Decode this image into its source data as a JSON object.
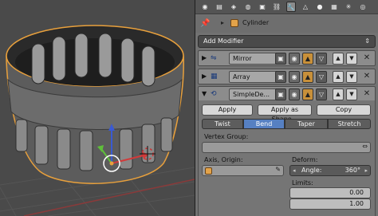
{
  "object": {
    "name": "Cylinder"
  },
  "toolbar": {
    "tabs": [
      {
        "icon": "render-icon",
        "glyph": "◉"
      },
      {
        "icon": "layers-icon",
        "glyph": "▤"
      },
      {
        "icon": "scene-icon",
        "glyph": "◈"
      },
      {
        "icon": "world-icon",
        "glyph": "◍"
      },
      {
        "icon": "object-icon",
        "glyph": "▣"
      },
      {
        "icon": "constraints-icon",
        "glyph": "⛓"
      },
      {
        "icon": "modifiers-icon",
        "glyph": "🔧"
      },
      {
        "icon": "data-icon",
        "glyph": "△"
      },
      {
        "icon": "material-icon",
        "glyph": "●"
      },
      {
        "icon": "texture-icon",
        "glyph": "▦"
      },
      {
        "icon": "particles-icon",
        "glyph": "✳"
      },
      {
        "icon": "physics-icon",
        "glyph": "◎"
      }
    ],
    "active_tab": "modifiers-icon"
  },
  "add_modifier": {
    "label": "Add Modifier"
  },
  "modifiers": [
    {
      "name": "Mirror",
      "expanded": false,
      "icon": "mirror-icon"
    },
    {
      "name": "Array",
      "expanded": false,
      "icon": "array-icon"
    },
    {
      "name": "SimpleDe...",
      "expanded": true,
      "icon": "simpledeform-icon"
    }
  ],
  "simple_deform": {
    "apply_label": "Apply",
    "apply_shape_label": "Apply as Shape...",
    "copy_label": "Copy",
    "modes": [
      "Twist",
      "Bend",
      "Taper",
      "Stretch"
    ],
    "active_mode": "Bend",
    "vertex_group_label": "Vertex Group:",
    "vertex_group_value": "",
    "axis_origin_label": "Axis, Origin:",
    "axis_origin_value": "",
    "deform_label": "Deform:",
    "angle_label": "Angle:",
    "angle_value": "360°",
    "limits_label": "Limits:",
    "limit_min": "0.00",
    "limit_max": "1.00"
  },
  "colors": {
    "selected_mode": "#5680c2",
    "selection_outline": "#e8a03c",
    "x_axis": "#d23a3a",
    "y_axis": "#5fbf3a",
    "z_axis": "#3a5ad2"
  }
}
